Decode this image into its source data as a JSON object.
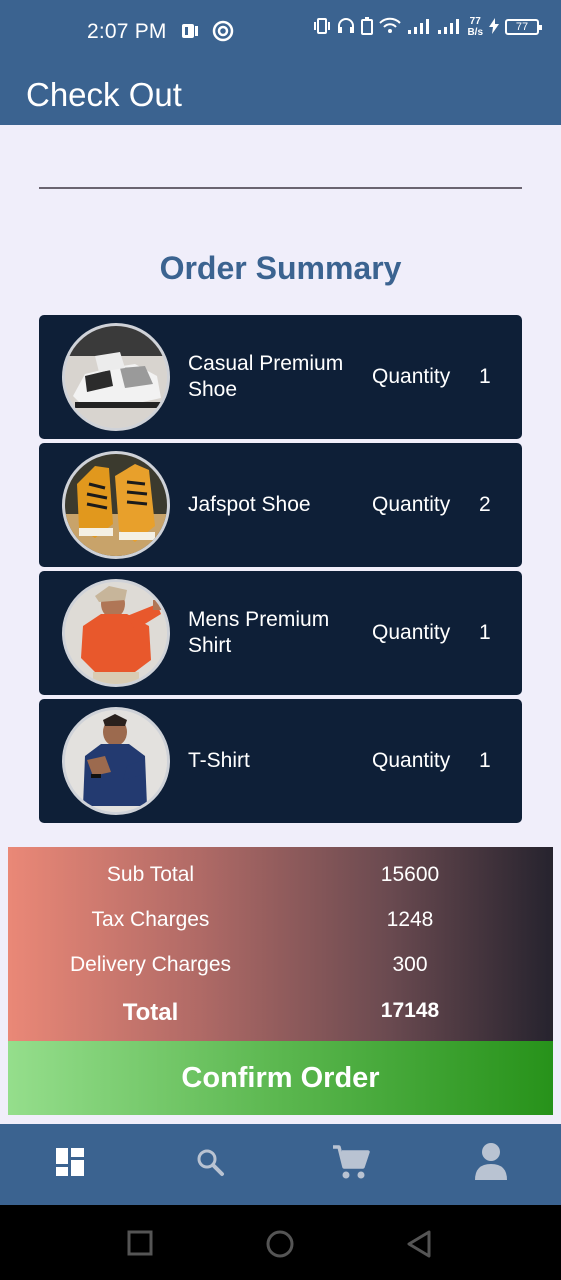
{
  "status_bar": {
    "time": "2:07 PM",
    "net_speed_value": "77",
    "net_speed_unit": "B/s",
    "battery_level": "77"
  },
  "app_bar": {
    "title": "Check Out"
  },
  "summary": {
    "title": "Order Summary",
    "items": [
      {
        "name": "Casual Premium Shoe",
        "qty_label": "Quantity",
        "qty": "1",
        "image": "shoe-sneaker-image"
      },
      {
        "name": "Jafspot Shoe",
        "qty_label": "Quantity",
        "qty": "2",
        "image": "shoe-orange-image"
      },
      {
        "name": "Mens Premium Shirt",
        "qty_label": "Quantity",
        "qty": "1",
        "image": "orange-shirt-image"
      },
      {
        "name": "T-Shirt",
        "qty_label": "Quantity",
        "qty": "1",
        "image": "navy-tshirt-image"
      }
    ]
  },
  "totals": {
    "subtotal_label": "Sub Total",
    "subtotal": "15600",
    "tax_label": "Tax Charges",
    "tax": "1248",
    "delivery_label": "Delivery Charges",
    "delivery": "300",
    "total_label": "Total",
    "total": "17148"
  },
  "actions": {
    "confirm_label": "Confirm Order"
  },
  "bottom_nav": {
    "items": [
      {
        "icon": "dashboard-icon",
        "active": true
      },
      {
        "icon": "search-icon",
        "active": false
      },
      {
        "icon": "cart-icon",
        "active": false
      },
      {
        "icon": "profile-icon",
        "active": false
      }
    ]
  },
  "colors": {
    "primary": "#3b6390",
    "card": "#0e1f37",
    "background": "#f0eefa",
    "confirm_green": "#27921a"
  }
}
